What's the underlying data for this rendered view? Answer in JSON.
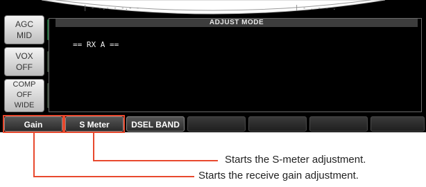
{
  "top_arc": {
    "fragment_left": "| - -.- - -.- -",
    "fragment_right": "| - . - - ."
  },
  "sidebar": {
    "agc": {
      "line1": "AGC",
      "line2": "MID"
    },
    "vox": {
      "line1": "VOX",
      "line2": "OFF"
    },
    "comp": {
      "line1": "COMP",
      "line2": "OFF",
      "line3": "WIDE"
    }
  },
  "display": {
    "header": "ADJUST MODE",
    "rx_line": "== RX A =="
  },
  "softkeys": {
    "gain": "Gain",
    "s_meter": "S Meter",
    "dsel_band": "DSEL BAND"
  },
  "callouts": {
    "s_meter": "Starts the S-meter adjustment.",
    "gain": "Starts the receive gain adjustment."
  },
  "colors": {
    "highlight": "#e8482d",
    "screen_bg": "#000000"
  }
}
